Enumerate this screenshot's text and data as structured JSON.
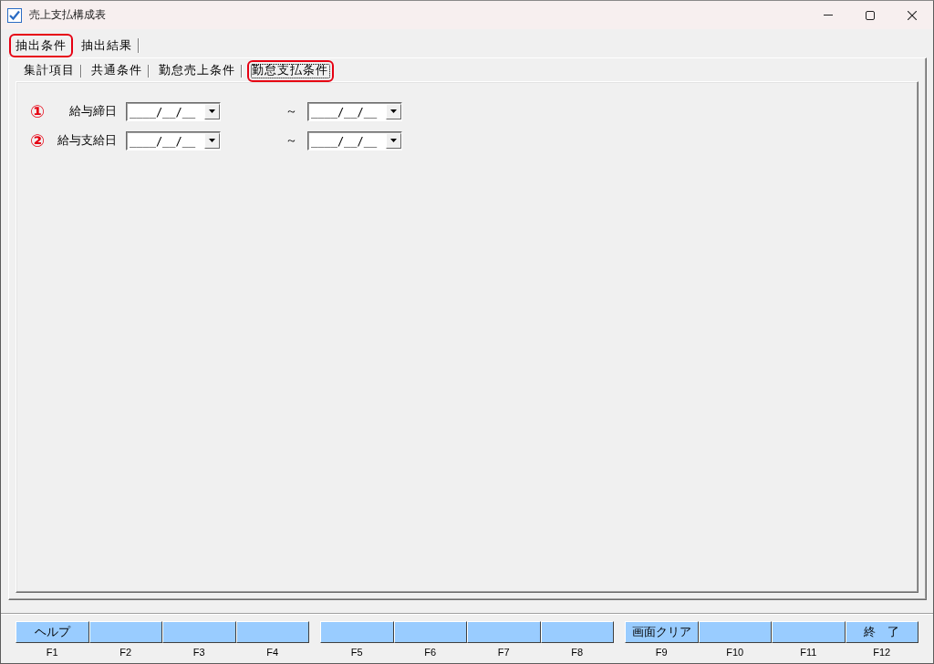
{
  "window": {
    "title": "売上支払構成表"
  },
  "tabs": [
    {
      "label": "抽出条件",
      "selected": true,
      "highlighted": true
    },
    {
      "label": "抽出結果",
      "selected": false,
      "highlighted": false
    }
  ],
  "subtabs": [
    {
      "label": "集計項目",
      "selected": false,
      "highlighted": false
    },
    {
      "label": "共通条件",
      "selected": false,
      "highlighted": false
    },
    {
      "label": "勤怠売上条件",
      "selected": false,
      "highlighted": false
    },
    {
      "label": "勤怠支払条件",
      "selected": true,
      "highlighted": true
    }
  ],
  "date_ranges": [
    {
      "marker": "①",
      "label": "給与締日",
      "from": {
        "value": "____/__/__"
      },
      "separator": "～",
      "to": {
        "value": "____/__/__"
      }
    },
    {
      "marker": "②",
      "label": "給与支給日",
      "from": {
        "value": "____/__/__"
      },
      "separator": "～",
      "to": {
        "value": "____/__/__"
      }
    }
  ],
  "function_keys": [
    {
      "label": "ヘルプ",
      "key": "F1"
    },
    {
      "key": "F2"
    },
    {
      "key": "F3"
    },
    {
      "key": "F4"
    },
    {
      "key": "F5"
    },
    {
      "key": "F6"
    },
    {
      "key": "F7"
    },
    {
      "key": "F8"
    },
    {
      "label": "画面クリア",
      "key": "F9"
    },
    {
      "key": "F10"
    },
    {
      "key": "F11"
    },
    {
      "label": "終　了",
      "key": "F12"
    }
  ]
}
